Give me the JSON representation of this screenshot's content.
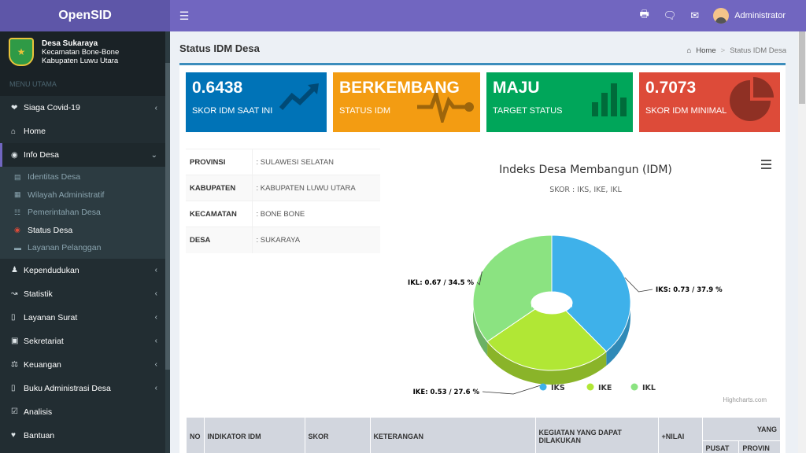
{
  "app": {
    "name": "OpenSID",
    "user": "Administrator"
  },
  "village": {
    "name": "Desa Sukaraya",
    "district": "Kecamatan Bone-Bone",
    "regency": "Kabupaten Luwu Utara"
  },
  "sidebar": {
    "header": "MENU UTAMA",
    "items": [
      {
        "label": "Siaga Covid-19",
        "icon": "heartbeat-icon"
      },
      {
        "label": "Home",
        "icon": "home-icon"
      },
      {
        "label": "Info Desa",
        "icon": "dashboard-icon"
      },
      {
        "label": "Kependudukan",
        "icon": "users-icon"
      },
      {
        "label": "Statistik",
        "icon": "line-chart-icon"
      },
      {
        "label": "Layanan Surat",
        "icon": "book-icon"
      },
      {
        "label": "Sekretariat",
        "icon": "archive-icon"
      },
      {
        "label": "Keuangan",
        "icon": "balance-scale-icon"
      },
      {
        "label": "Buku Administrasi Desa",
        "icon": "book-icon"
      },
      {
        "label": "Analisis",
        "icon": "check-square-icon"
      },
      {
        "label": "Bantuan",
        "icon": "heart-icon"
      }
    ],
    "sub_items": [
      {
        "label": "Identitas Desa",
        "icon": "id-card-icon"
      },
      {
        "label": "Wilayah Administratif",
        "icon": "map-icon"
      },
      {
        "label": "Pemerintahan Desa",
        "icon": "sitemap-icon"
      },
      {
        "label": "Status Desa",
        "icon": "dot-circle-icon"
      },
      {
        "label": "Layanan Pelanggan",
        "icon": "credit-card-icon"
      }
    ]
  },
  "page": {
    "title": "Status IDM Desa"
  },
  "breadcrumb": {
    "home": "Home",
    "current": "Status IDM Desa"
  },
  "tiles": [
    {
      "value": "0.6438",
      "label": "SKOR IDM SAAT INI",
      "color": "#0073b7"
    },
    {
      "value": "BERKEMBANG",
      "label": "STATUS IDM",
      "color": "#f39c12"
    },
    {
      "value": "MAJU",
      "label": "TARGET STATUS",
      "color": "#00a65a"
    },
    {
      "value": "0.7073",
      "label": "SKOR IDM MINIMAL",
      "color": "#dd4b39"
    }
  ],
  "info": [
    {
      "key": "PROVINSI",
      "value": ": SULAWESI SELATAN"
    },
    {
      "key": "KABUPATEN",
      "value": ": KABUPATEN LUWU UTARA"
    },
    {
      "key": "KECAMATAN",
      "value": ": BONE BONE"
    },
    {
      "key": "DESA",
      "value": ": SUKARAYA"
    }
  ],
  "chart_data": {
    "type": "pie",
    "title": "Indeks Desa Membangun (IDM)",
    "subtitle": "SKOR : IKS, IKE, IKL",
    "labels": [
      "IKS",
      "IKE",
      "IKL"
    ],
    "values": [
      0.73,
      0.53,
      0.67
    ],
    "percentages": [
      37.9,
      27.6,
      34.5
    ],
    "data_labels": [
      "IKS: 0.73 / 37.9 %",
      "IKE: 0.53 / 27.6 %",
      "IKL: 0.67 / 34.5 %"
    ],
    "colors": [
      "#3eb1ea",
      "#b1e735",
      "#8be381"
    ],
    "legend_placement": "bottom-center",
    "credits": "Highcharts.com"
  },
  "table": {
    "headers": [
      "NO",
      "INDIKATOR IDM",
      "SKOR",
      "KETERANGAN",
      "KEGIATAN YANG DAPAT DILAKUKAN",
      "+NILAI",
      "YANG",
      "PUSAT",
      "PROVIN"
    ]
  }
}
